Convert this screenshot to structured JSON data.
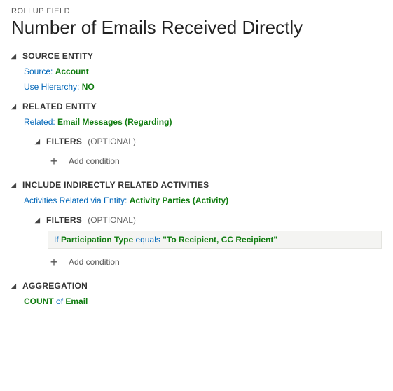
{
  "breadcrumb": "ROLLUP FIELD",
  "title": "Number of Emails Received Directly",
  "sections": {
    "source": {
      "header": "SOURCE ENTITY",
      "sourceLabel": "Source:",
      "sourceValue": "Account",
      "hierarchyLabel": "Use Hierarchy:",
      "hierarchyValue": "NO"
    },
    "related": {
      "header": "RELATED ENTITY",
      "relatedLabel": "Related:",
      "relatedEntity": "Email Messages",
      "relatedParenOpen": "(",
      "relatedField": "Regarding",
      "relatedParenClose": ")",
      "filters": {
        "header": "FILTERS",
        "optional": "(OPTIONAL)",
        "addLabel": "Add condition"
      }
    },
    "indirect": {
      "header": "INCLUDE INDIRECTLY RELATED ACTIVITIES",
      "viaLabel": "Activities Related via Entity:",
      "viaEntity": "Activity Parties",
      "viaParenOpen": "(",
      "viaField": "Activity",
      "viaParenClose": ")",
      "filters": {
        "header": "FILTERS",
        "optional": "(OPTIONAL)",
        "condition": {
          "if": "If",
          "field": "Participation Type",
          "op": "equals",
          "value": "\"To Recipient, CC Recipient\""
        },
        "addLabel": "Add condition"
      }
    },
    "aggregation": {
      "header": "AGGREGATION",
      "func": "COUNT",
      "of": "of",
      "field": "Email"
    }
  }
}
